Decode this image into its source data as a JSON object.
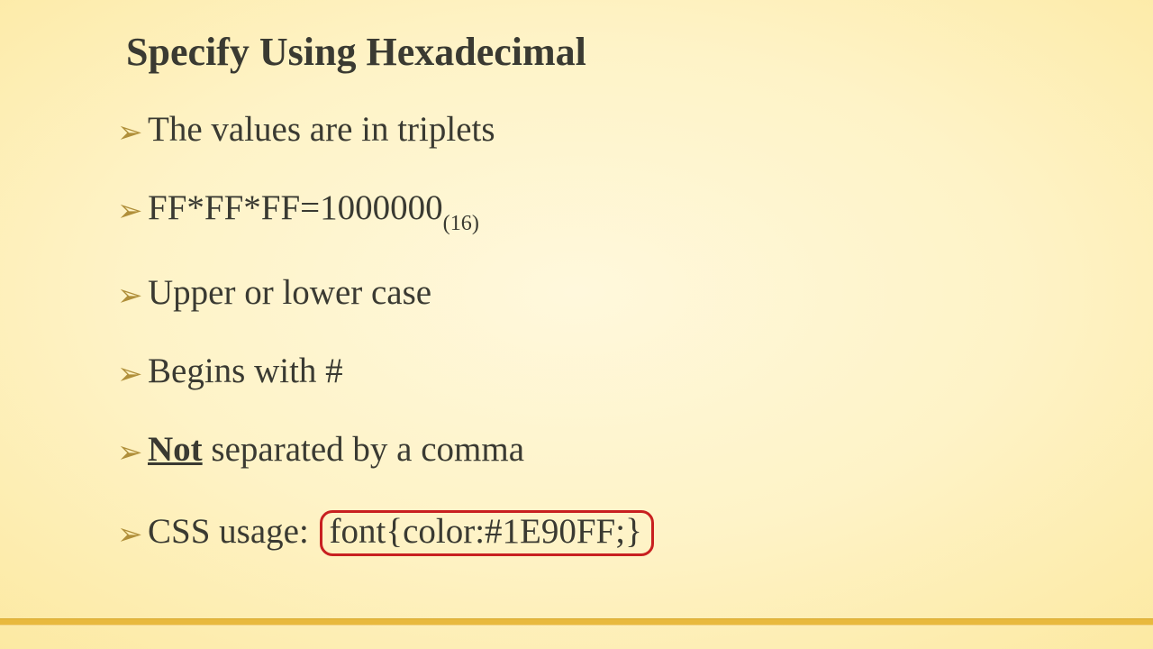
{
  "title": "Specify Using Hexadecimal",
  "bullets": {
    "b1": "The values are in triplets",
    "b2_main": "FF*FF*FF=1000000",
    "b2_sub": "(16)",
    "b3": "Upper or lower case",
    "b4": "Begins with #",
    "b5_emph": "Not",
    "b5_rest": " separated by a comma",
    "b6_lead": "CSS usage: ",
    "b6_code": "font{color:#1E90FF;}"
  },
  "glyphs": {
    "bullet": "➢"
  }
}
